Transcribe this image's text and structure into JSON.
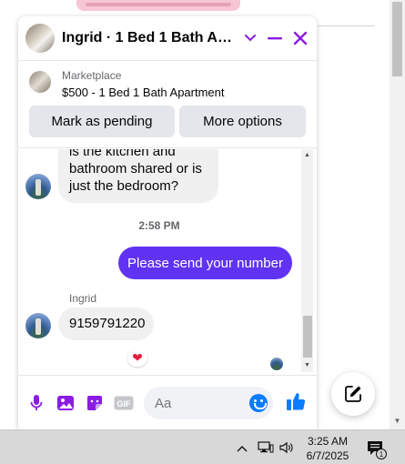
{
  "header": {
    "title": "Ingrid · 1 Bed 1 Bath Apartment"
  },
  "listing": {
    "kicker": "Marketplace",
    "title": "$500 - 1 Bed 1 Bath Apartment",
    "pending_label": "Mark as pending",
    "more_label": "More options"
  },
  "messages": {
    "incoming_1": "is the kitchen and bathroom shared or is just the bedroom?",
    "timestamp": "2:58 PM",
    "outgoing_1": "Please send your number",
    "sender_name": "Ingrid",
    "incoming_2": "9159791220",
    "reaction": "❤"
  },
  "composer": {
    "placeholder": "Aa",
    "gif_label": "GIF"
  },
  "taskbar": {
    "time": "3:25 AM",
    "date": "6/7/2025",
    "notification_count": "1"
  },
  "colors": {
    "accent": "#8a1be3",
    "outgoing_bubble": "#6033f3",
    "link_blue": "#0a7cff"
  }
}
